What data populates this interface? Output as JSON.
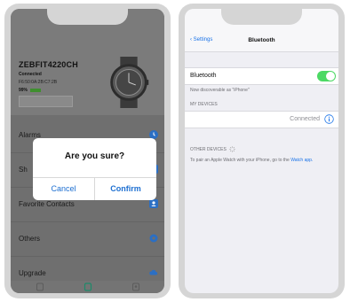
{
  "left_screen": {
    "device": {
      "name": "ZEBFIT4220CH",
      "status": "Connected",
      "mac": "F6:50:0A:2B:C7:2B",
      "battery": "99%",
      "battery_level": 0.99,
      "button_label": ""
    },
    "menu": [
      {
        "label": "Alarms",
        "icon": "clock-icon"
      },
      {
        "label": "Sh",
        "icon": "settings-icon"
      },
      {
        "label": "Favorite Contacts",
        "icon": "contacts-icon"
      },
      {
        "label": "Others",
        "icon": "gear-icon"
      },
      {
        "label": "Upgrade",
        "icon": "cloud-icon"
      }
    ],
    "tabs": [
      "watch-icon",
      "device-icon",
      "profile-icon"
    ],
    "alert": {
      "title": "Are you sure?",
      "cancel_label": "Cancel",
      "confirm_label": "Confirm"
    },
    "colors": {
      "accent": "#1d6fd1",
      "menu_icon": "#2b6fc4"
    }
  },
  "right_screen": {
    "nav": {
      "back_label": "Settings",
      "title": "Bluetooth"
    },
    "bluetooth": {
      "label": "Bluetooth",
      "enabled": true
    },
    "discoverable": "Now discoverable as \"iPhone\"",
    "my_devices_header": "MY DEVICES",
    "device_status": "Connected",
    "other_devices_header": "OTHER DEVICES",
    "pair_note": "To pair an Apple Watch with your iPhone, go to the",
    "pair_link": "Watch app.",
    "colors": {
      "toggle_on": "#4cd964",
      "link": "#1a73e8"
    }
  }
}
